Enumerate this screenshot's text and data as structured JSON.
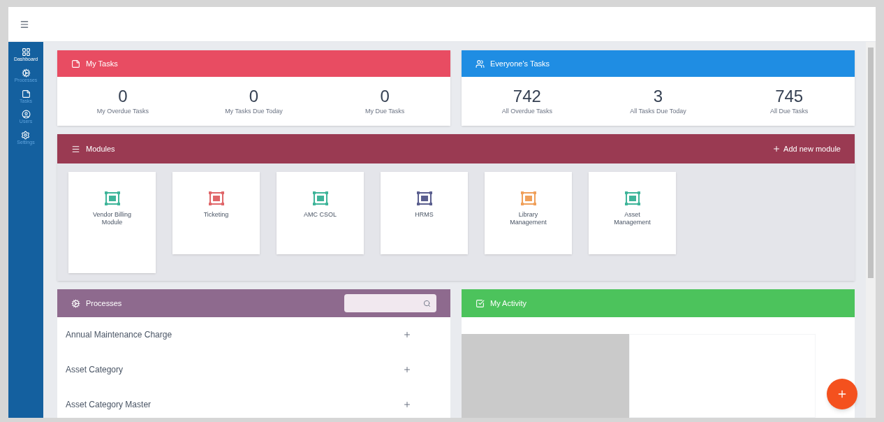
{
  "sidebar": {
    "items": [
      {
        "label": "Dashboard",
        "selected": true
      },
      {
        "label": "Processes",
        "selected": false
      },
      {
        "label": "Tasks",
        "selected": false
      },
      {
        "label": "Users",
        "selected": false
      },
      {
        "label": "Settings",
        "selected": false
      }
    ]
  },
  "my_tasks": {
    "title": "My Tasks",
    "stats": [
      {
        "value": "0",
        "label": "My Overdue Tasks"
      },
      {
        "value": "0",
        "label": "My Tasks Due Today"
      },
      {
        "value": "0",
        "label": "My Due Tasks"
      }
    ]
  },
  "everyones_tasks": {
    "title": "Everyone's Tasks",
    "stats": [
      {
        "value": "742",
        "label": "All Overdue Tasks"
      },
      {
        "value": "3",
        "label": "All Tasks Due Today"
      },
      {
        "value": "745",
        "label": "All Due Tasks"
      }
    ]
  },
  "modules": {
    "title": "Modules",
    "add_button": "Add new module",
    "items": [
      {
        "name": "Vendor Billing Module",
        "color": "#3fb59a"
      },
      {
        "name": "Ticketing",
        "color": "#e0676a"
      },
      {
        "name": "AMC CSOL",
        "color": "#3fb59a"
      },
      {
        "name": "HRMS",
        "color": "#5b5f8f"
      },
      {
        "name": "Library Management",
        "color": "#f0a05a"
      },
      {
        "name": "Asset Management",
        "color": "#3fb59a"
      }
    ]
  },
  "processes": {
    "title": "Processes",
    "items": [
      "Annual Maintenance Charge",
      "Asset Category",
      "Asset Category Master"
    ]
  },
  "activity": {
    "title": "My Activity"
  }
}
